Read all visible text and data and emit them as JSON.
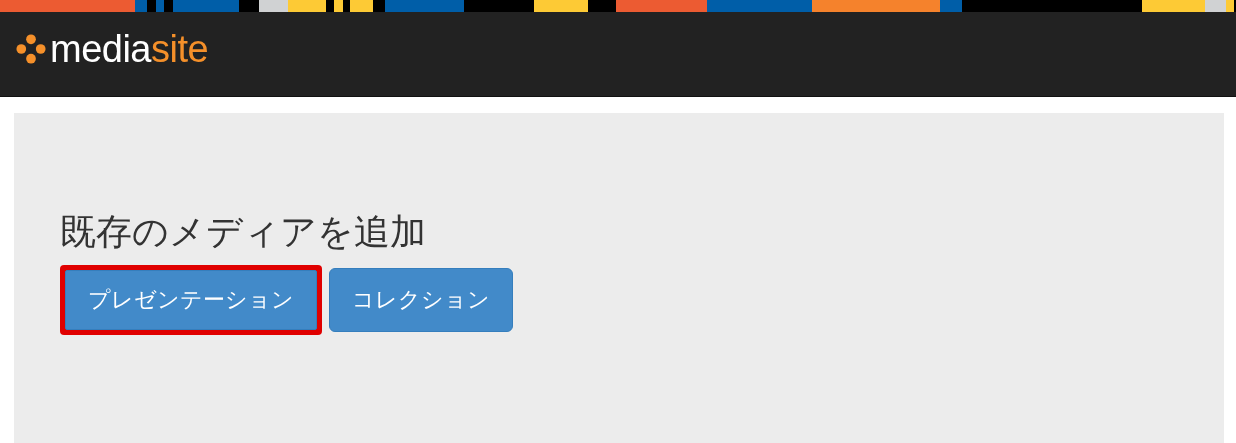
{
  "header": {
    "logo": {
      "primary": "media",
      "accent": "site"
    }
  },
  "panel": {
    "title": "既存のメディアを追加",
    "buttons": [
      {
        "label": "プレゼンテーション",
        "highlighted": true
      },
      {
        "label": "コレクション",
        "highlighted": false
      }
    ]
  }
}
